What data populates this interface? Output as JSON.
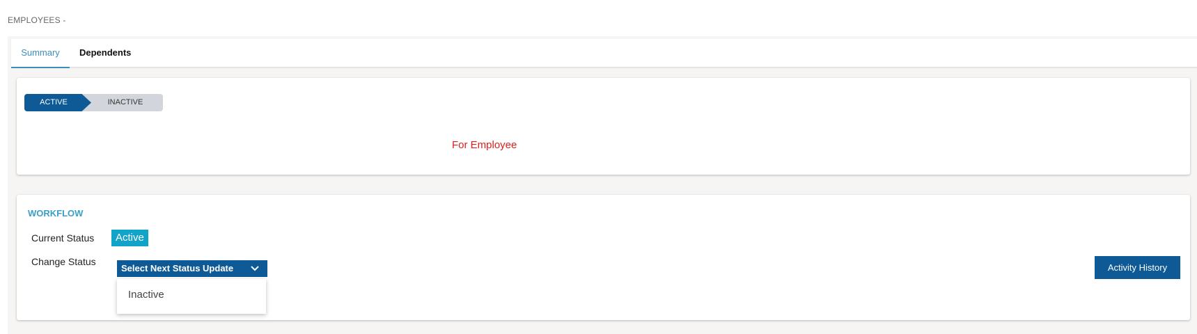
{
  "header": {
    "title": "EMPLOYEES -"
  },
  "tabs": [
    {
      "label": "Summary",
      "active": true
    },
    {
      "label": "Dependents",
      "active": false
    }
  ],
  "status_path": {
    "steps": [
      {
        "label": "ACTIVE",
        "active": true
      },
      {
        "label": "INACTIVE",
        "active": false
      }
    ]
  },
  "summary": {
    "message": "For Employee",
    "message_color": "#e21b1b"
  },
  "workflow": {
    "title": "WORKFLOW",
    "current_status_label": "Current Status",
    "current_status_value": "Active",
    "change_status_label": "Change Status",
    "select_placeholder": "Select Next Status Update",
    "options": [
      "Inactive"
    ],
    "activity_history_label": "Activity History"
  },
  "colors": {
    "primary": "#0d5a97",
    "accent": "#3a8fc0",
    "badge": "#11a3c8"
  }
}
